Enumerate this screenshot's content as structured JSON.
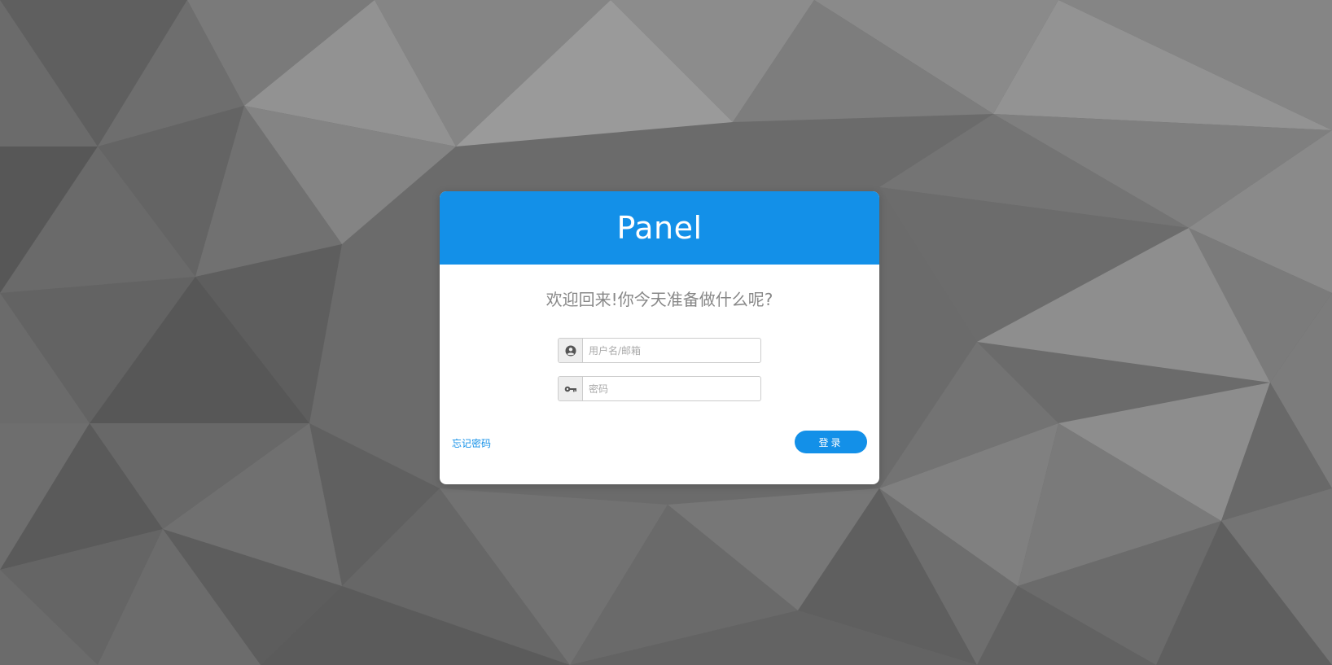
{
  "brand": {
    "title": "Panel"
  },
  "welcome": {
    "text": "欢迎回来!你今天准备做什么呢?"
  },
  "form": {
    "username_placeholder": "用户名/邮箱",
    "username_value": "",
    "password_placeholder": "密码",
    "password_value": "",
    "username_icon": "user-circle-icon",
    "password_icon": "key-icon"
  },
  "actions": {
    "forgot_label": "忘记密码",
    "login_label": "登录"
  },
  "colors": {
    "accent": "#1390e8",
    "background": "#6b6b6b",
    "card": "#ffffff",
    "muted_text": "#888888"
  }
}
